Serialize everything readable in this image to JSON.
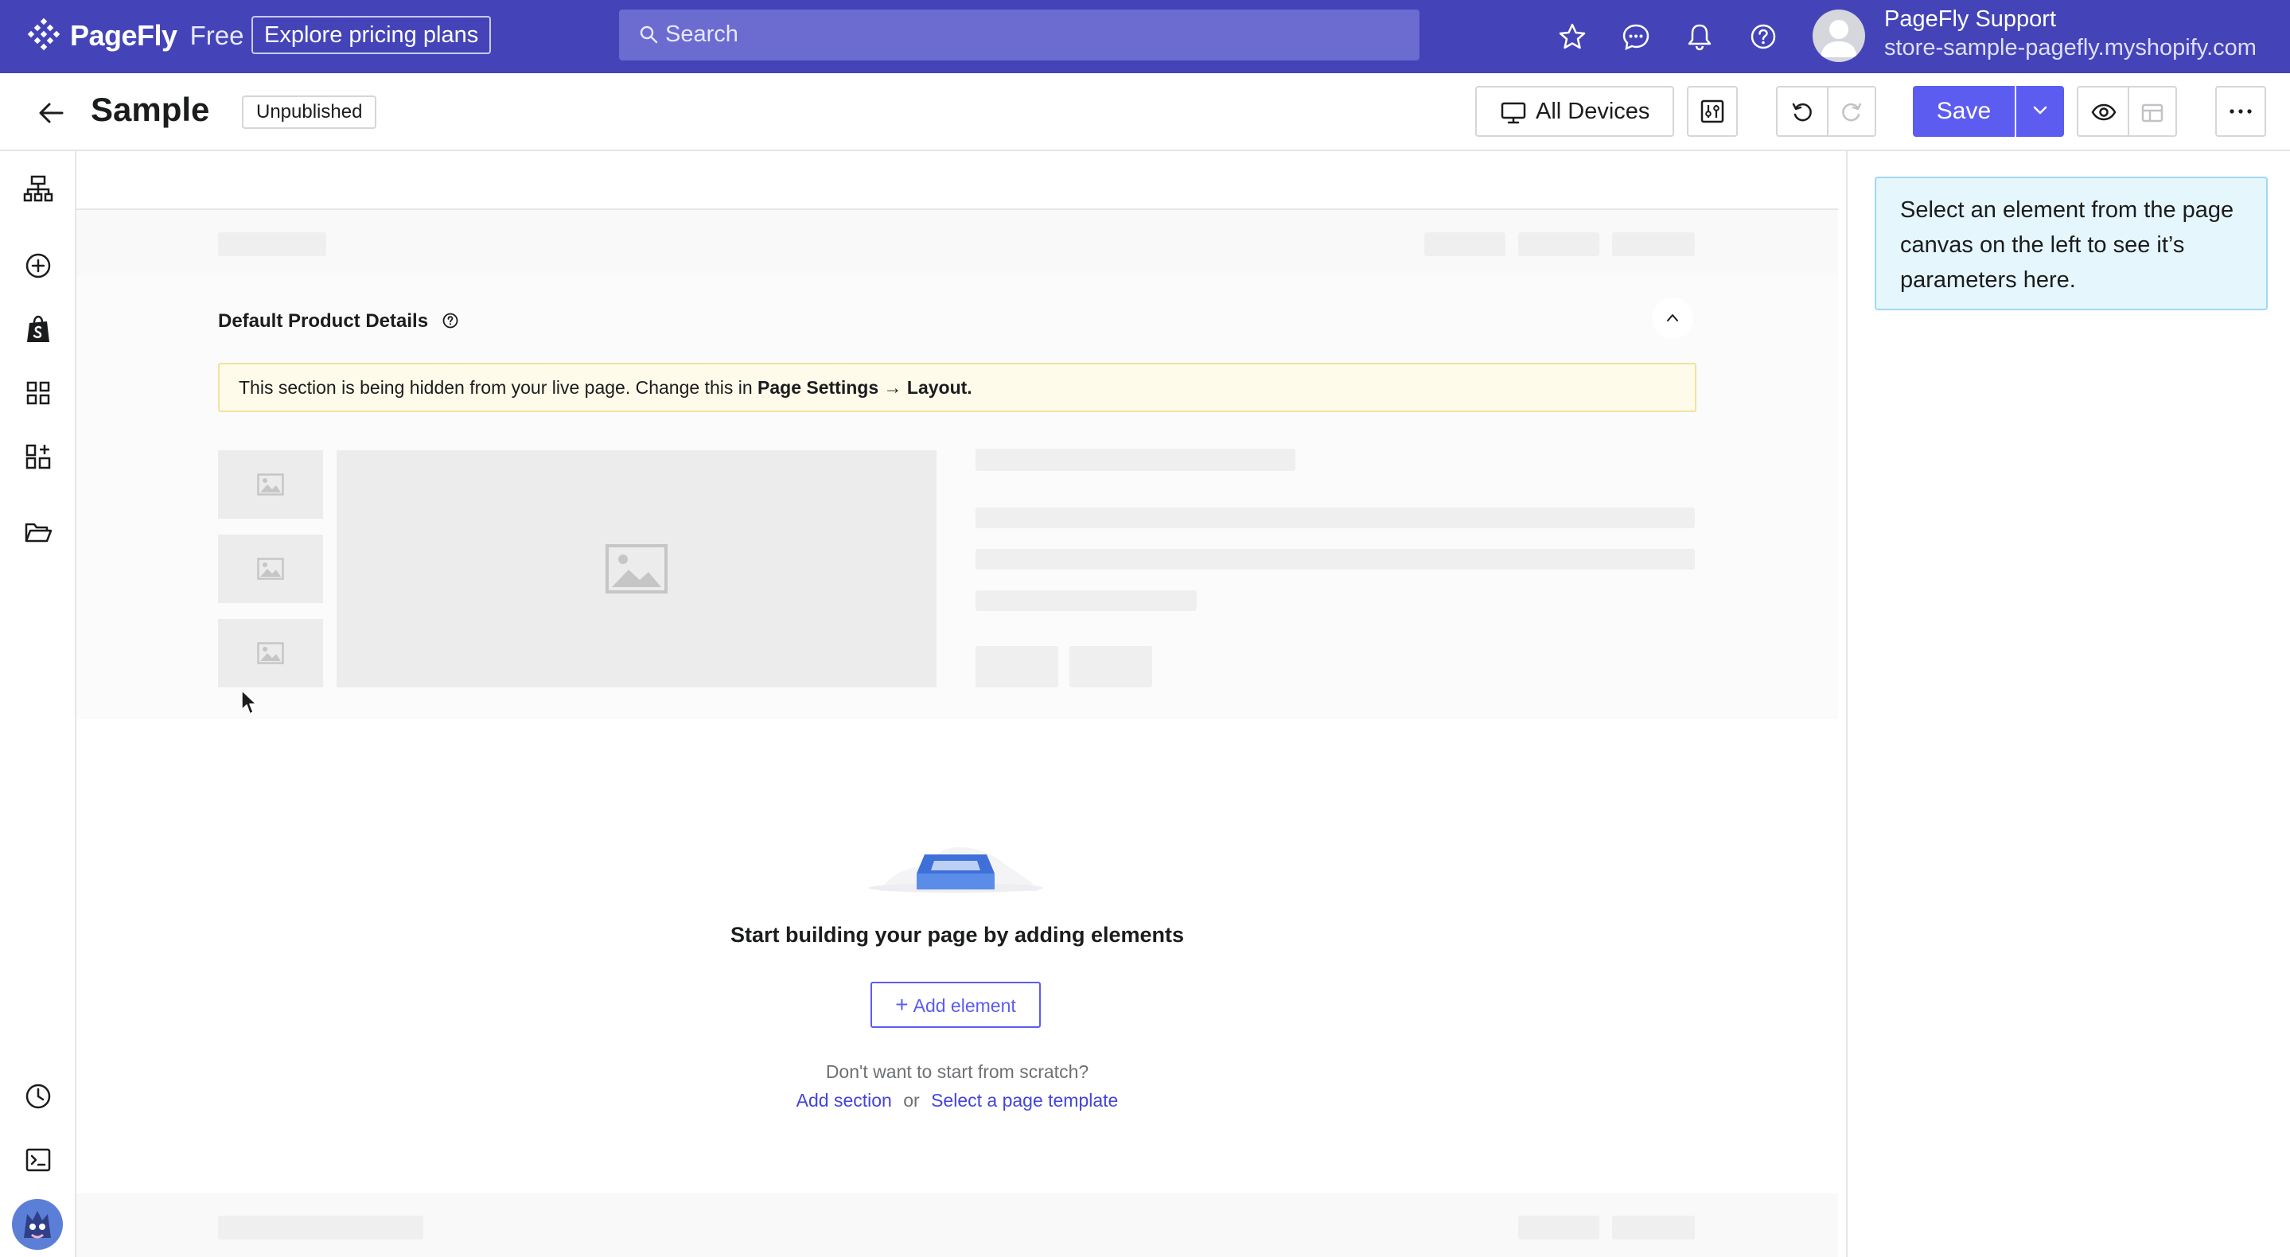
{
  "topbar": {
    "brand": "PageFly",
    "tier": "Free",
    "pricing_button": "Explore pricing plans",
    "search_placeholder": "Search",
    "icons": [
      "star-icon",
      "chat-icon",
      "bell-icon",
      "help-icon"
    ],
    "user_name": "PageFly Support",
    "user_store": "store-sample-pagefly.myshopify.com",
    "bg_color": "#4444b8"
  },
  "toolbar": {
    "page_title": "Sample",
    "status": "Unpublished",
    "devices_label": "All Devices",
    "save_label": "Save",
    "save_color": "#5c5cf0"
  },
  "rail": {
    "icons": [
      "layers-icon",
      "add-circle-icon",
      "shopify-bag-icon",
      "grid-icon",
      "apps-add-icon",
      "folder-open-icon",
      "history-icon",
      "terminal-icon",
      "mascot-avatar"
    ]
  },
  "panel": {
    "hint": "Select an element from the page canvas on the left to see it’s parameters here."
  },
  "canvas": {
    "section_title": "Default Product Details",
    "notice_text": "This section is being hidden from your live page. Change this in ",
    "notice_bold": "Page Settings → Layout.",
    "empty_title": "Start building your page by adding elements",
    "add_element": "Add element",
    "scratch_question": "Don't want to start from scratch?",
    "add_section": "Add section",
    "or": "or",
    "select_template": "Select a page template"
  }
}
